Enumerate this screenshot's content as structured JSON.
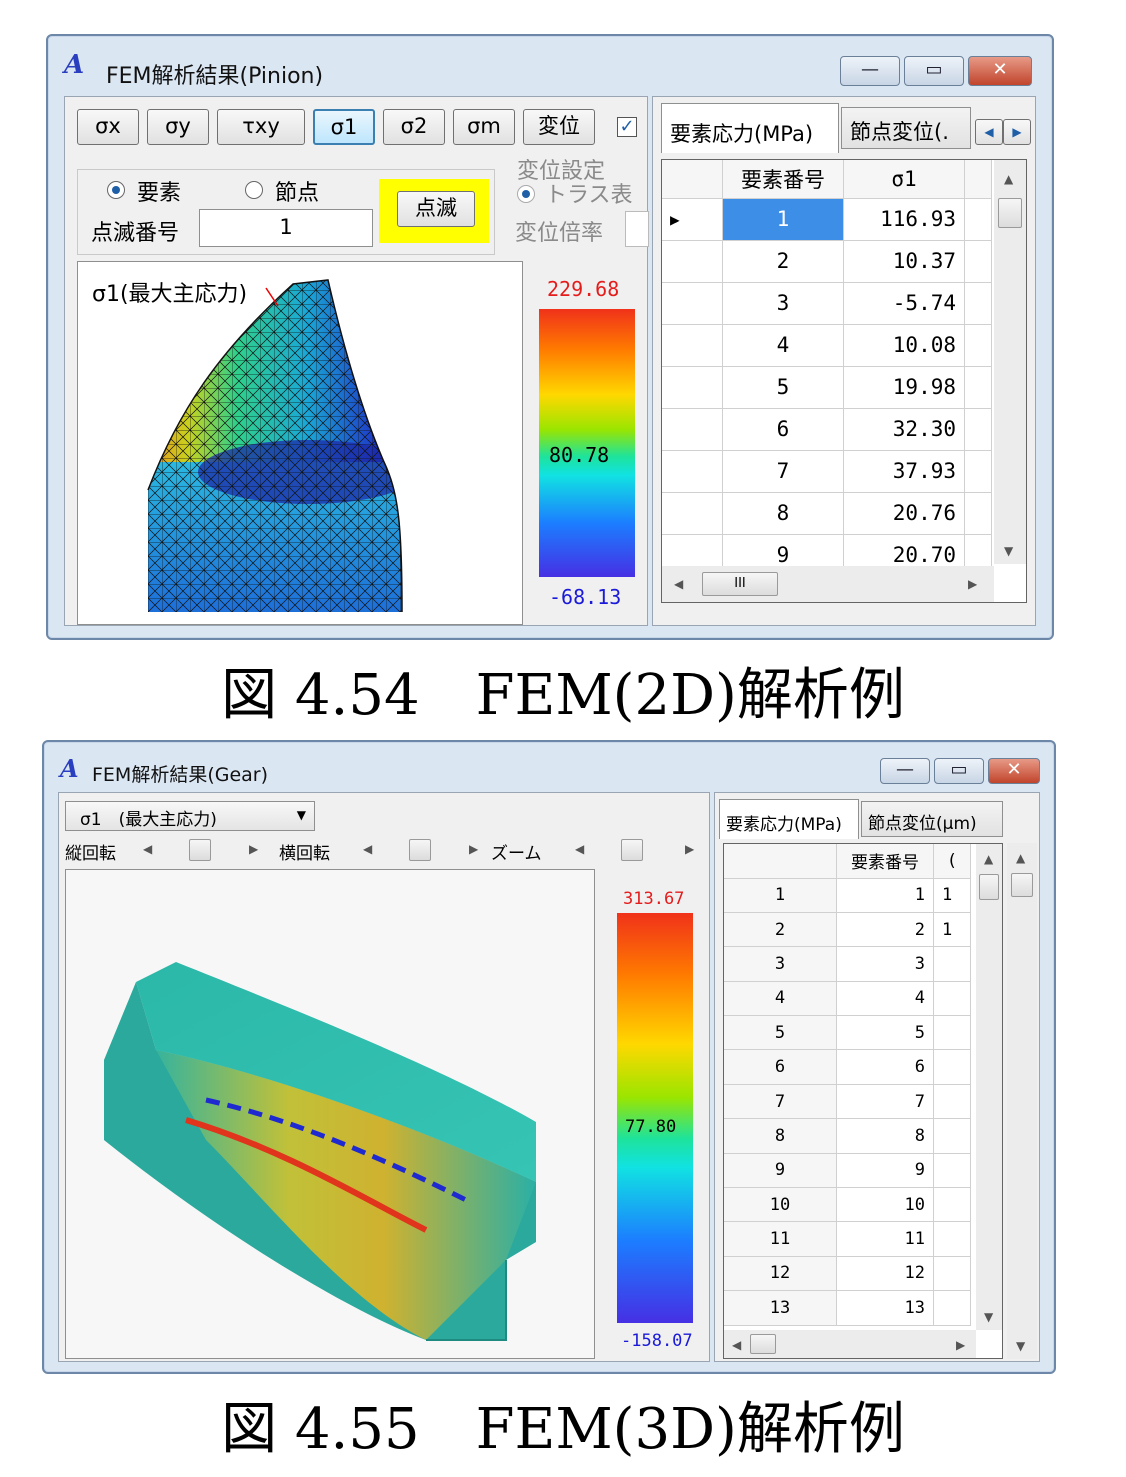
{
  "fig1": {
    "window_title": "FEM解析結果(Pinion)",
    "toolbar": [
      "σx",
      "σy",
      "τxy",
      "σ1",
      "σ2",
      "σm",
      "変位"
    ],
    "selected_toolbar": "σ1",
    "radio_element": "要素",
    "radio_node": "節点",
    "blink_label": "点滅番号",
    "blink_value": "1",
    "blink_button": "点滅",
    "disp_group": "変位設定",
    "truss_label": "トラス表",
    "disp_scale_label": "変位倍率",
    "plot_title": "σ1(最大主応力)",
    "color_max": "229.68",
    "color_mid": "80.78",
    "color_min": "-68.13",
    "tab_active": "要素応力(MPa)",
    "tab_other": "節点変位(.",
    "col_header_num": "要素番号",
    "col_header_val": "σ1",
    "rows": [
      {
        "num": "1",
        "val": "116.93"
      },
      {
        "num": "2",
        "val": "10.37"
      },
      {
        "num": "3",
        "val": "-5.74"
      },
      {
        "num": "4",
        "val": "10.08"
      },
      {
        "num": "5",
        "val": "19.98"
      },
      {
        "num": "6",
        "val": "32.30"
      },
      {
        "num": "7",
        "val": "37.93"
      },
      {
        "num": "8",
        "val": "20.76"
      },
      {
        "num": "9",
        "val": "20.70"
      }
    ],
    "hscroll_thumb": "III"
  },
  "caption1": "図 4.54　FEM(2D)解析例",
  "fig2": {
    "window_title": "FEM解析結果(Gear)",
    "combo_value": "σ1　(最大主応力)",
    "vrot_label": "縦回転",
    "hrot_label": "横回転",
    "zoom_label": "ズーム",
    "color_max": "313.67",
    "color_mid": "77.80",
    "color_min": "-158.07",
    "tab_active": "要素応力(MPa)",
    "tab_other": "節点変位(μm)",
    "col_header_num": "要素番号",
    "col_header_val": "(",
    "rows": [
      {
        "idx": "1",
        "num": "1",
        "extra": "1"
      },
      {
        "idx": "2",
        "num": "2",
        "extra": "1"
      },
      {
        "idx": "3",
        "num": "3",
        "extra": ""
      },
      {
        "idx": "4",
        "num": "4",
        "extra": ""
      },
      {
        "idx": "5",
        "num": "5",
        "extra": ""
      },
      {
        "idx": "6",
        "num": "6",
        "extra": ""
      },
      {
        "idx": "7",
        "num": "7",
        "extra": ""
      },
      {
        "idx": "8",
        "num": "8",
        "extra": ""
      },
      {
        "idx": "9",
        "num": "9",
        "extra": ""
      },
      {
        "idx": "10",
        "num": "10",
        "extra": ""
      },
      {
        "idx": "11",
        "num": "11",
        "extra": ""
      },
      {
        "idx": "12",
        "num": "12",
        "extra": ""
      },
      {
        "idx": "13",
        "num": "13",
        "extra": ""
      }
    ]
  },
  "caption2": "図 4.55　FEM(3D)解析例",
  "colors": {
    "selected_cell": "#3d8ee6",
    "highlight": "#ffff00",
    "max_label": "#e51c1c",
    "min_label": "#1a1ad8"
  }
}
